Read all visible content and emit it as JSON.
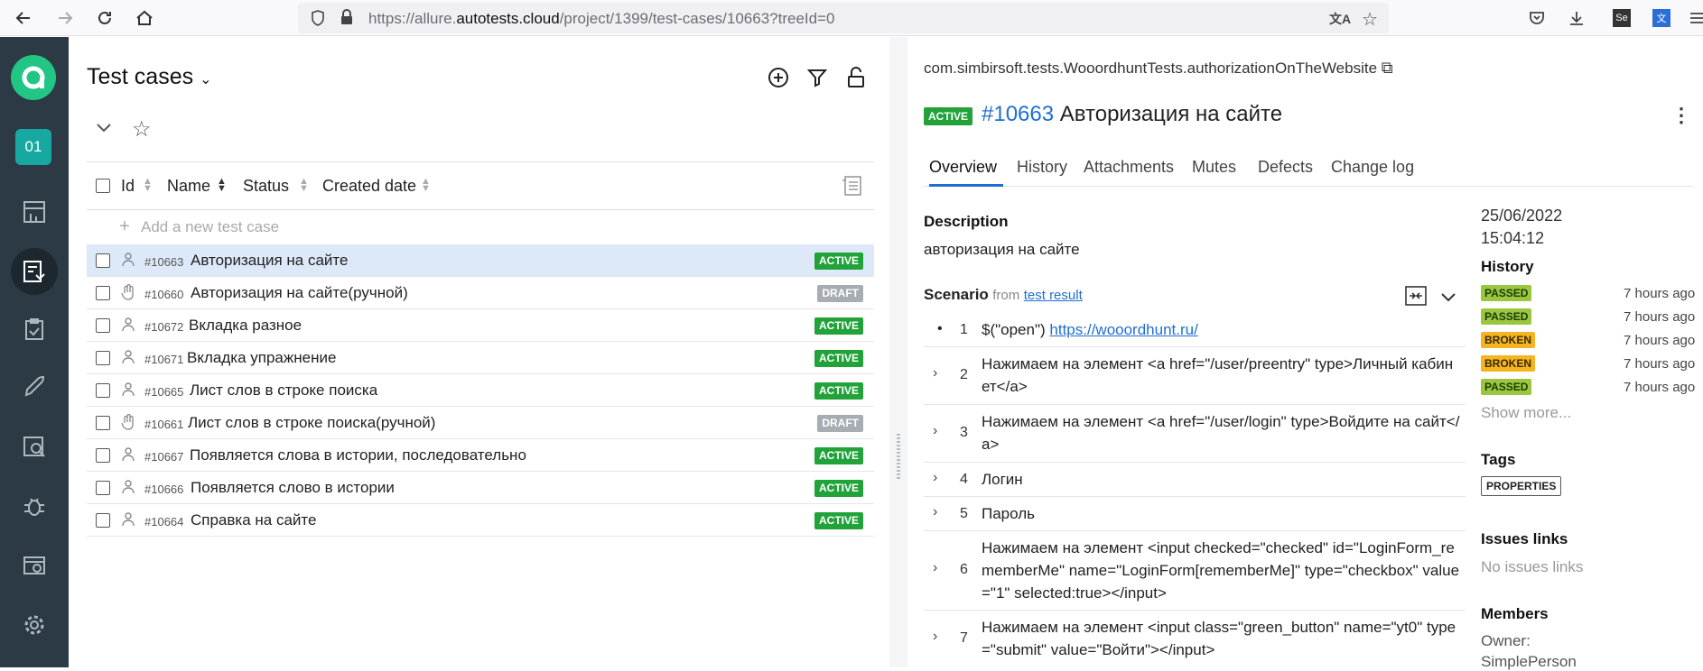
{
  "browser": {
    "url_prefix": "https://allure.",
    "url_domain": "autotests.cloud",
    "url_suffix": "/project/1399/test-cases/10663?treeId=0"
  },
  "sidebar": {
    "project_badge": "01",
    "icons": [
      "dashboard-icon",
      "test-cases-icon",
      "test-plans-icon",
      "launches-icon",
      "analytics-icon",
      "defects-icon",
      "jobs-icon",
      "settings-icon"
    ]
  },
  "left": {
    "title": "Test cases",
    "columns": {
      "id": "Id",
      "name": "Name",
      "status": "Status",
      "created": "Created date"
    },
    "add_placeholder": "Add a new test case",
    "rows": [
      {
        "id": "#10663",
        "name": "Авторизация на сайте",
        "status": "ACTIVE",
        "type": "auto",
        "selected": true
      },
      {
        "id": "#10660",
        "name": "Авторизация на сайте(ручной)",
        "status": "DRAFT",
        "type": "manual"
      },
      {
        "id": "#10672",
        "name": "Вкладка разное",
        "status": "ACTIVE",
        "type": "auto"
      },
      {
        "id": "#10671",
        "name": "Вкладка упражнение",
        "status": "ACTIVE",
        "type": "auto"
      },
      {
        "id": "#10665",
        "name": "Лист слов в строке поиска",
        "status": "ACTIVE",
        "type": "auto"
      },
      {
        "id": "#10661",
        "name": "Лист слов в строке поиска(ручной)",
        "status": "DRAFT",
        "type": "manual"
      },
      {
        "id": "#10667",
        "name": "Появляется слова в истории, последовательно",
        "status": "ACTIVE",
        "type": "auto"
      },
      {
        "id": "#10666",
        "name": "Появляется слово в истории",
        "status": "ACTIVE",
        "type": "auto"
      },
      {
        "id": "#10664",
        "name": "Справка на сайте",
        "status": "ACTIVE",
        "type": "auto"
      }
    ]
  },
  "right": {
    "fqn": "com.simbirsoft.tests.WooordhuntTests.authorizationOnTheWebsite",
    "status": "ACTIVE",
    "case_id": "#10663",
    "case_name": "Авторизация на сайте",
    "tabs": [
      "Overview",
      "History",
      "Attachments",
      "Mutes",
      "Defects",
      "Change log"
    ],
    "description_label": "Description",
    "description": "авторизация на сайте",
    "scenario_label": "Scenario",
    "scenario_from": "from",
    "scenario_source": "test result",
    "steps": [
      {
        "num": "1",
        "pre": "$(\"open\") ",
        "link": "https://wooordhunt.ru/"
      },
      {
        "num": "2",
        "text": "Нажимаем на элемент <a href=\"/user/preentry\" type>Личный кабинет</a>"
      },
      {
        "num": "3",
        "text": "Нажимаем на элемент <a href=\"/user/login\" type>Войдите на сайт</a>"
      },
      {
        "num": "4",
        "text": "Логин"
      },
      {
        "num": "5",
        "text": "Пароль"
      },
      {
        "num": "6",
        "text": "Нажимаем на элемент <input checked=\"checked\" id=\"LoginForm_rememberMe\" name=\"LoginForm[rememberMe]\" type=\"checkbox\" value=\"1\" selected:true></input>"
      },
      {
        "num": "7",
        "text": "Нажимаем на элемент <input class=\"green_button\" name=\"yt0\" type=\"submit\" value=\"Войти\"></input>"
      }
    ],
    "meta": {
      "date": "25/06/2022",
      "time": "15:04:12",
      "history_label": "History",
      "history": [
        {
          "status": "PASSED",
          "when": "7 hours ago"
        },
        {
          "status": "PASSED",
          "when": "7 hours ago"
        },
        {
          "status": "BROKEN",
          "when": "7 hours ago"
        },
        {
          "status": "BROKEN",
          "when": "7 hours ago"
        },
        {
          "status": "PASSED",
          "when": "7 hours ago"
        }
      ],
      "show_more": "Show more...",
      "tags_label": "Tags",
      "tags": [
        "PROPERTIES"
      ],
      "issues_label": "Issues links",
      "issues_empty": "No issues links",
      "members_label": "Members",
      "owner_label": "Owner:",
      "owner": "SimplePerson"
    }
  }
}
